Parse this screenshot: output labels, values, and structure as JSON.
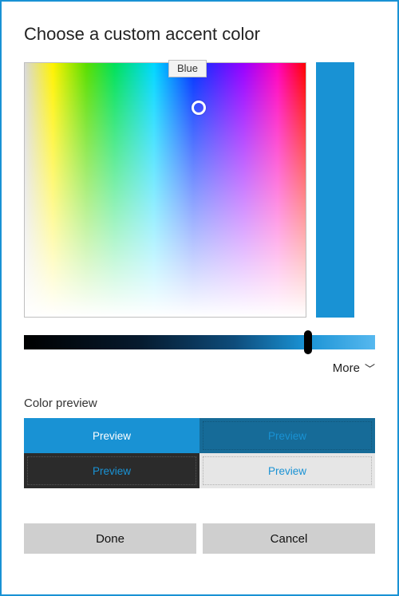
{
  "title": "Choose a custom accent color",
  "tooltip": "Blue",
  "selected_color": "#1992d4",
  "more": {
    "label": "More"
  },
  "preview": {
    "section_label": "Color preview",
    "cell_label": "Preview"
  },
  "buttons": {
    "done": "Done",
    "cancel": "Cancel"
  }
}
